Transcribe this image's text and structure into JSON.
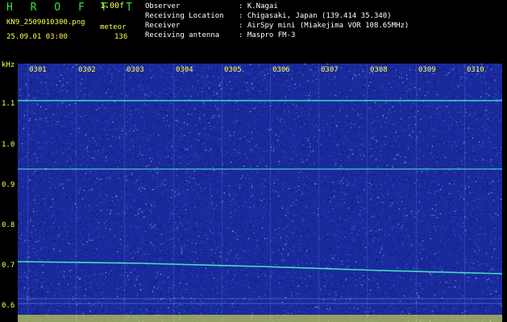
{
  "header": {
    "app_title": "H R O F F T",
    "version": "1.00f",
    "filename": "KN9_2509010300.png",
    "meteor_label": "meteor",
    "meteor_count": "136",
    "datetime": "25.09.01 03:00"
  },
  "info": [
    {
      "key": "Observer",
      "value": ": K.Nagai"
    },
    {
      "key": "Receiving Location",
      "value": ": Chigasaki, Japan (139.414 35.340)"
    },
    {
      "key": "Receiver",
      "value": ": AirSpy mini (Miakejima VOR 108.65MHz)"
    },
    {
      "key": "Receiving antenna",
      "value": ": Maspro FM-3"
    }
  ],
  "axis": {
    "unit": "kHz",
    "y_ticks": [
      "1.1",
      "1.0",
      "0.9",
      "0.8",
      "0.7",
      "0.6"
    ],
    "x_ticks": [
      "0301",
      "0302",
      "0303",
      "0304",
      "0305",
      "0306",
      "0307",
      "0308",
      "0309",
      "0310"
    ]
  },
  "colors": {
    "background": "#000000",
    "spectrogram": "#1a2a9c",
    "label_yellow": "#ffff48",
    "title_green": "#3ee13e",
    "trace_cyan": "#40e8d0"
  }
}
